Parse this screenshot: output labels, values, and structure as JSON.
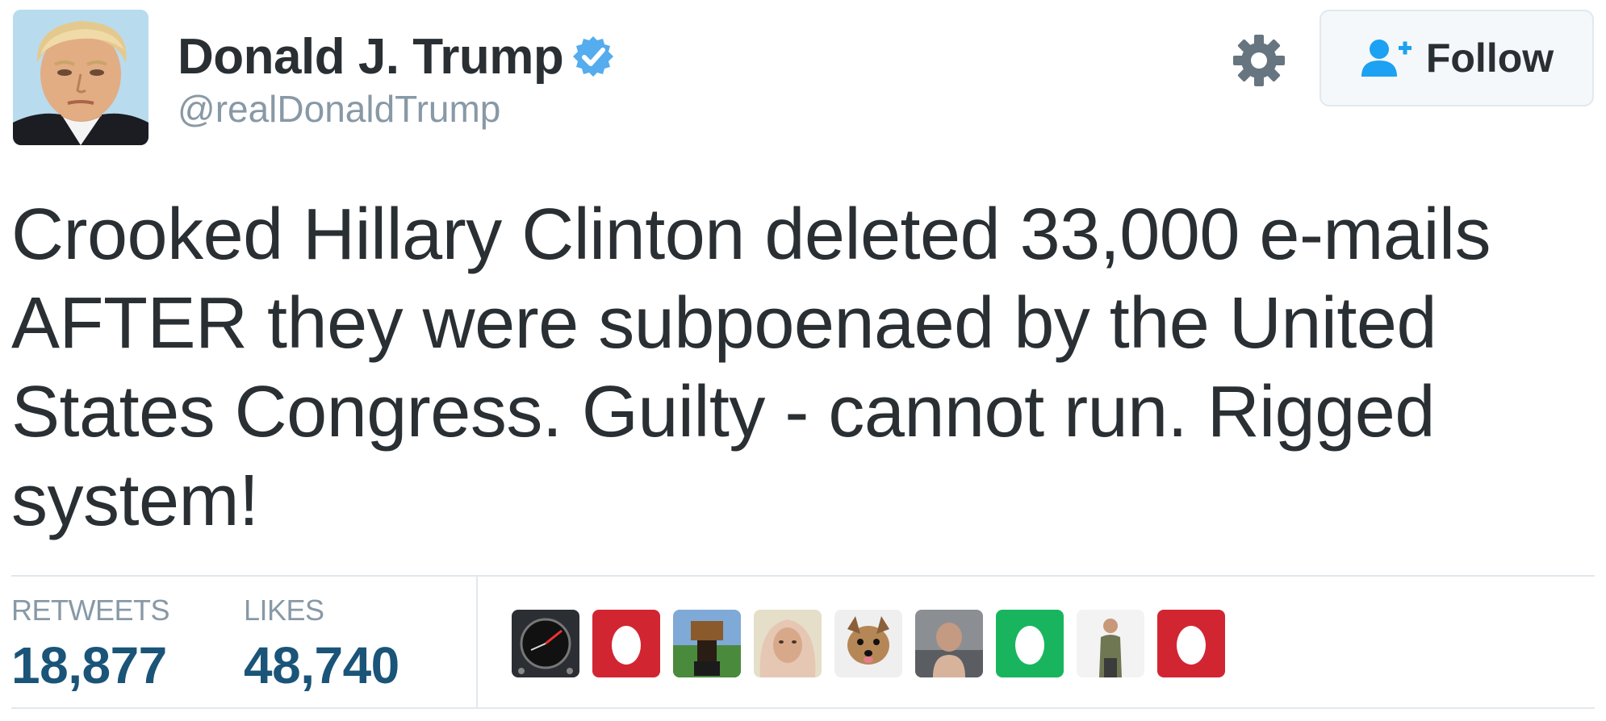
{
  "user": {
    "name": "Donald J. Trump",
    "handle": "@realDonaldTrump",
    "verified": true
  },
  "follow_button": {
    "label": "Follow",
    "icon": "add-user-icon"
  },
  "settings_icon": "gear-icon",
  "tweet": {
    "text": "Crooked Hillary Clinton deleted 33,000 e-mails AFTER they were subpoenaed by the United States Congress. Guilty - cannot run. Rigged system!"
  },
  "stats": {
    "retweets_label": "RETWEETS",
    "retweets_value": "18,877",
    "likes_label": "LIKES",
    "likes_value": "48,740"
  },
  "likers": [
    {
      "type": "photo",
      "icon": "dark-gauge-avatar"
    },
    {
      "type": "egg",
      "color": "#d12632",
      "icon": "egg-avatar"
    },
    {
      "type": "photo",
      "icon": "stadium-avatar"
    },
    {
      "type": "photo",
      "icon": "person-headscarf-avatar"
    },
    {
      "type": "photo",
      "icon": "dog-avatar"
    },
    {
      "type": "photo",
      "icon": "person-photo-avatar"
    },
    {
      "type": "egg",
      "color": "#19b55e",
      "icon": "egg-avatar"
    },
    {
      "type": "photo",
      "icon": "standing-man-avatar"
    },
    {
      "type": "egg",
      "color": "#d12632",
      "icon": "egg-avatar"
    }
  ],
  "colors": {
    "text": "#292f33",
    "muted": "#8899a6",
    "stat_value": "#1a5478",
    "verified_blue": "#55acee",
    "follow_icon_blue": "#1da1f2",
    "border": "#e1e8ed"
  }
}
